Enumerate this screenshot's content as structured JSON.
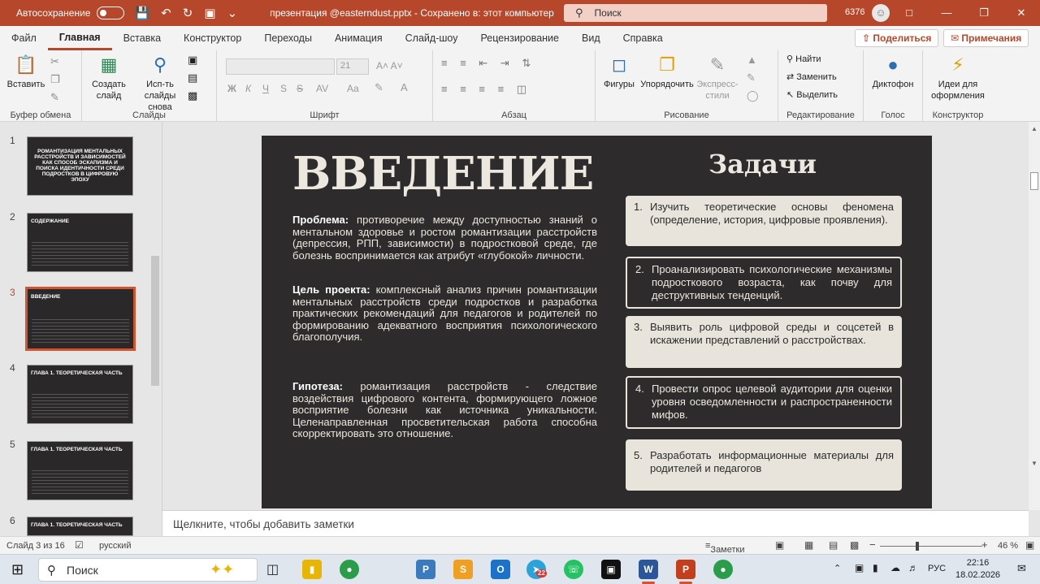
{
  "titlebar": {
    "autosave_label": "Автосохранение",
    "document": "презентация @easterndust.pptx  -  Сохранено в: этот компьютер",
    "search_placeholder": "Поиск",
    "user_number": "6376",
    "accent_color": "#b7472a"
  },
  "menu": {
    "tabs": [
      "Файл",
      "Главная",
      "Вставка",
      "Конструктор",
      "Переходы",
      "Анимация",
      "Слайд-шоу",
      "Рецензирование",
      "Вид",
      "Справка"
    ],
    "active_tab": "Главная",
    "share": "Поделиться",
    "comments": "Примечания"
  },
  "ribbon": {
    "clipboard": {
      "paste": "Вставить",
      "label": "Буфер обмена"
    },
    "slides": {
      "new_slide": "Создать слайд",
      "reuse": "Исп-ть слайды снова",
      "label": "Слайды"
    },
    "font": {
      "size": "21",
      "bold": "Ж",
      "italic": "К",
      "underline": "Ч",
      "strike": "S",
      "label": "Шрифт"
    },
    "paragraph": {
      "label": "Абзац"
    },
    "drawing": {
      "shapes": "Фигуры",
      "arrange": "Упорядочить",
      "quick_styles": "Экспресс-стили",
      "label": "Рисование"
    },
    "editing": {
      "find": "Найти",
      "replace": "Заменить",
      "select": "Выделить",
      "label": "Редактирование"
    },
    "voice": {
      "dictate": "Диктофон",
      "label": "Голос"
    },
    "designer": {
      "ideas": "Идеи для оформления",
      "label": "Конструктор"
    }
  },
  "thumbnails": [
    {
      "number": "1",
      "title": "РОМАНТИЗАЦИЯ МЕНТАЛЬНЫХ РАССТРОЙСТВ И ЗАВИСИМОСТЕЙ КАК СПОСОБ ЭСКАПИЗМА И ПОИСКА ИДЕНТИЧНОСТИ СРЕДИ ПОДРОСТКОВ В ЦИФРОВУЮ ЭПОХУ"
    },
    {
      "number": "2",
      "title": "СОДЕРЖАНИЕ"
    },
    {
      "number": "3",
      "title": "ВВЕДЕНИЕ",
      "active": true
    },
    {
      "number": "4",
      "title": "ГЛАВА 1. ТЕОРЕТИЧЕСКАЯ ЧАСТЬ"
    },
    {
      "number": "5",
      "title": "ГЛАВА 1. ТЕОРЕТИЧЕСКАЯ ЧАСТЬ"
    },
    {
      "number": "6",
      "title": "ГЛАВА 1. ТЕОРЕТИЧЕСКАЯ ЧАСТЬ"
    }
  ],
  "slide": {
    "title": "ВВЕДЕНИЕ",
    "tasks_title": "Задачи",
    "problem_label": "Проблема:",
    "problem_text": " противоречие между доступностью знаний о ментальном здоровье и ростом романтизации расстройств (депрессия, РПП, зависимости) в подростковой среде, где болезнь воспринимается как атрибут «глубокой» личности.",
    "goal_label": "Цель проекта:",
    "goal_text": " комплексный анализ причин романтизации ментальных расстройств среди подростков и разработка практических рекомендаций для педагогов и родителей по формированию адекватного восприятия психологического благополучия.",
    "hypothesis_label": "Гипотеза:",
    "hypothesis_text": " романтизация расстройств - следствие воздействия цифрового контента, формирующего ложное восприятие болезни как источника уникальности. Целенаправленная просветительская работа способна скорректировать это отношение.",
    "tasks": [
      {
        "num": "1.",
        "text": "Изучить теоретические основы феномена (определение, история, цифровые проявления)."
      },
      {
        "num": "2.",
        "text": "Проанализировать психологические механизмы подросткового возраста, как почву для деструктивных тенденций."
      },
      {
        "num": "3.",
        "text": "Выявить роль цифровой среды и соцсетей в искажении представлений о расстройствах."
      },
      {
        "num": "4.",
        "text": "Провести опрос целевой аудитории для оценки уровня осведомленности и распространенности мифов."
      },
      {
        "num": "5.",
        "text": "Разработать информационные материалы для родителей и педагогов"
      }
    ]
  },
  "notes_placeholder": "Щелкните, чтобы добавить заметки",
  "status": {
    "slide_counter": "Слайд 3 из 16",
    "language": "русский",
    "notes": "Заметки",
    "zoom": "46 %"
  },
  "taskbar": {
    "search": "Поиск",
    "time": "22:16",
    "date": "18.02.2026",
    "lang": "РУС",
    "telegram_badge": "22"
  }
}
